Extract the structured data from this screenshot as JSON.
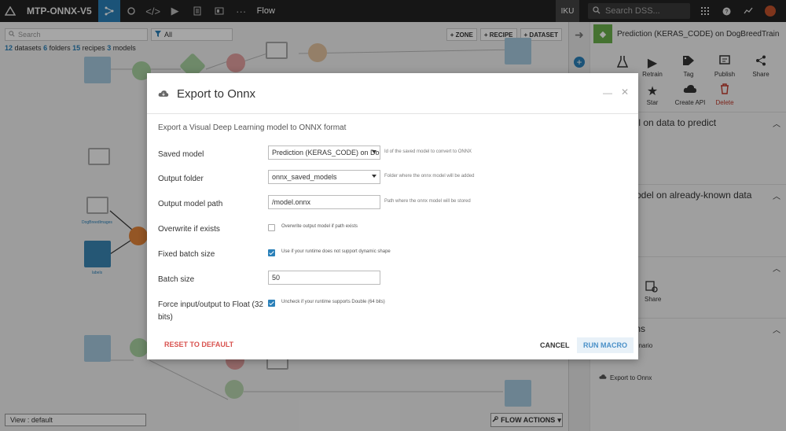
{
  "topnav": {
    "project": "MTP-ONNX-V5",
    "section": "Flow",
    "instance": "IKU",
    "search_placeholder": "Search DSS..."
  },
  "flow": {
    "search_placeholder": "Search",
    "filter_value": "All",
    "zone_label": "+ ZONE",
    "recipe_label": "+ RECIPE",
    "dataset_label": "+ DATASET",
    "counts": {
      "datasets": "12",
      "datasets_word": "datasets",
      "folders": "6",
      "folders_word": "folders",
      "recipes": "15",
      "recipes_word": "recipes",
      "models": "3",
      "models_word": "models"
    },
    "view": "View : default",
    "flow_actions": "FLOW ACTIONS",
    "labels": {
      "dog_breed_images": "DogBreedImages",
      "labels": "labels"
    }
  },
  "right_panel": {
    "title": "Prediction (KERAS_CODE) on DogBreedTrain",
    "actions": [
      {
        "label": "Retrain",
        "icon": "play-icon"
      },
      {
        "label": "Tag",
        "icon": "tag-icon"
      },
      {
        "label": "Publish",
        "icon": "publish-icon"
      },
      {
        "label": "Share",
        "icon": "share-icon"
      },
      {
        "label": "Star",
        "icon": "star-icon"
      },
      {
        "label": "Create API",
        "icon": "cloud-icon"
      },
      {
        "label": "Delete",
        "icon": "trash-icon"
      }
    ],
    "sections": [
      {
        "title": "del on data to predict"
      },
      {
        "title": "model on already-known data"
      },
      {
        "title": "s"
      },
      {
        "title": "ions"
      }
    ],
    "share_label": "Share",
    "scenario_fragment": "enario",
    "export_item": "Export to Onnx"
  },
  "modal": {
    "title": "Export to Onnx",
    "description": "Export a Visual Deep Learning model to ONNX format",
    "fields": {
      "saved_model": {
        "label": "Saved model",
        "value": "Prediction (KERAS_CODE) on Dog",
        "help": "Id of the saved model to convert to ONNX"
      },
      "output_folder": {
        "label": "Output folder",
        "value": "onnx_saved_models",
        "help": "Folder where the onnx model will be added"
      },
      "output_path": {
        "label": "Output model path",
        "value": "/model.onnx",
        "help": "Path where the onnx model will be stored"
      },
      "overwrite": {
        "label": "Overwrite if exists",
        "checked": false,
        "help": "Overwrite output model if path exists"
      },
      "fixed_batch": {
        "label": "Fixed batch size",
        "checked": true,
        "help": "Use if your runtime does not support dynamic shape"
      },
      "batch_size": {
        "label": "Batch size",
        "value": "50"
      },
      "force_float": {
        "label": "Force input/output to Float (32 bits)",
        "checked": true,
        "help": "Uncheck if your runtime supports Double (64 bits)"
      }
    },
    "reset_label": "RESET TO DEFAULT",
    "cancel_label": "CANCEL",
    "run_label": "RUN MACRO"
  },
  "colors": {
    "accent": "#2a80b9",
    "danger": "#d9534f",
    "nav_bg": "#222222"
  }
}
